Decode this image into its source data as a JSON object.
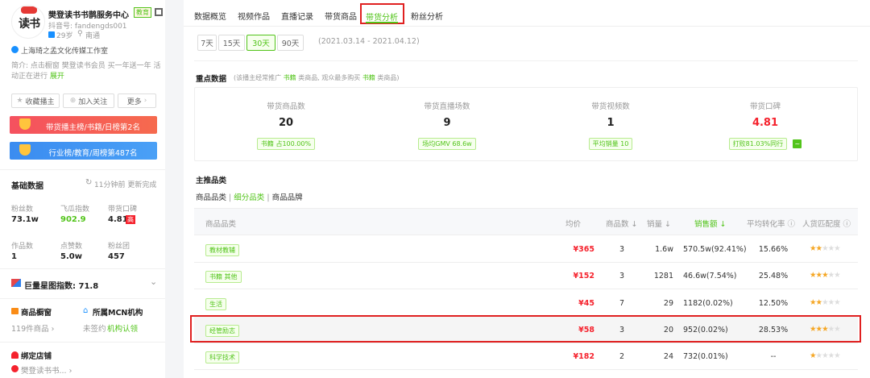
{
  "profile": {
    "name": "樊登读书书鹊服务中心",
    "edu_badge": "教育",
    "avatar_tag": "读书",
    "douyin_id": "抖音号: fandengds001",
    "age": "29岁",
    "location": "南通",
    "company": "上海琦之孟文化传媒工作室",
    "intro": "简介: 点击橱窗 樊登读书会员 买一年送一年 活动正在进行",
    "intro_more": "展开"
  },
  "actions": {
    "favorite": "收藏播主",
    "follow": "加入关注",
    "more": "更多"
  },
  "banners": {
    "rank1": "带货播主榜/书籍/日榜第2名",
    "rank2": "行业榜/教育/周榜第487名"
  },
  "basic": {
    "title": "基础数据",
    "update": "11分钟前 更新完成",
    "fans_label": "粉丝数",
    "fans_value": "73.1w",
    "feigua_label": "飞瓜指数",
    "feigua_value": "902.9",
    "koubei_label": "带货口碑",
    "koubei_value": "4.81",
    "koubei_badge": "高",
    "works_label": "作品数",
    "works_value": "1",
    "likes_label": "点赞数",
    "likes_value": "5.0w",
    "fanclub_label": "粉丝团",
    "fanclub_value": "457"
  },
  "star_index": {
    "label": "巨量星图指数: 71.8"
  },
  "shop": {
    "window_label": "商品橱窗",
    "window_value": "119件商品",
    "mcn_label": "所属MCN机构",
    "mcn_value": "未签约",
    "mcn_link": "机构认领",
    "bind_label": "绑定店铺",
    "store_name": "樊登读书书..."
  },
  "tabs": [
    "数据概览",
    "视频作品",
    "直播记录",
    "带货商品",
    "带货分析",
    "粉丝分析"
  ],
  "range": {
    "options": [
      "7天",
      "15天",
      "30天",
      "90天"
    ],
    "active": "30天",
    "dates": "(2021.03.14 - 2021.04.12)"
  },
  "key_data": {
    "title": "重点数据",
    "desc_prefix": "(该播主经常推广",
    "desc_cat1": "书籍",
    "desc_mid": "类商品, 观众最多购买",
    "desc_cat2": "书籍",
    "desc_suffix": "类商品)",
    "cards": [
      {
        "label": "带货商品数",
        "value": "20",
        "tag": "书籍 占100.00%"
      },
      {
        "label": "带货直播场数",
        "value": "9",
        "tag": "场均GMV 68.6w"
      },
      {
        "label": "带货视频数",
        "value": "1",
        "tag": "平均销量 10"
      },
      {
        "label": "带货口碑",
        "value": "4.81",
        "tag": "打败81.03%同行"
      }
    ]
  },
  "categories": {
    "title": "主推品类",
    "subtabs": [
      "商品品类",
      "细分品类",
      "商品品牌"
    ],
    "sep": "|",
    "columns": {
      "name": "商品品类",
      "price": "均价",
      "count": "商品数",
      "sales": "销量",
      "revenue": "销售额",
      "conversion": "平均转化率",
      "match": "人货匹配度"
    },
    "rows": [
      {
        "name": "教材教辅",
        "price": "¥365",
        "count": "3",
        "sales": "1.6w",
        "revenue": "570.5w(92.41%)",
        "conversion": "15.66%",
        "stars": 2
      },
      {
        "name": "书籍 其他",
        "price": "¥152",
        "count": "3",
        "sales": "1281",
        "revenue": "46.6w(7.54%)",
        "conversion": "25.48%",
        "stars": 3
      },
      {
        "name": "生活",
        "price": "¥45",
        "count": "7",
        "sales": "29",
        "revenue": "1182(0.02%)",
        "conversion": "12.50%",
        "stars": 2
      },
      {
        "name": "经管励志",
        "price": "¥58",
        "count": "3",
        "sales": "20",
        "revenue": "952(0.02%)",
        "conversion": "28.53%",
        "stars": 3
      },
      {
        "name": "科学技术",
        "price": "¥182",
        "count": "2",
        "sales": "24",
        "revenue": "732(0.01%)",
        "conversion": "--",
        "stars": 1
      }
    ]
  }
}
